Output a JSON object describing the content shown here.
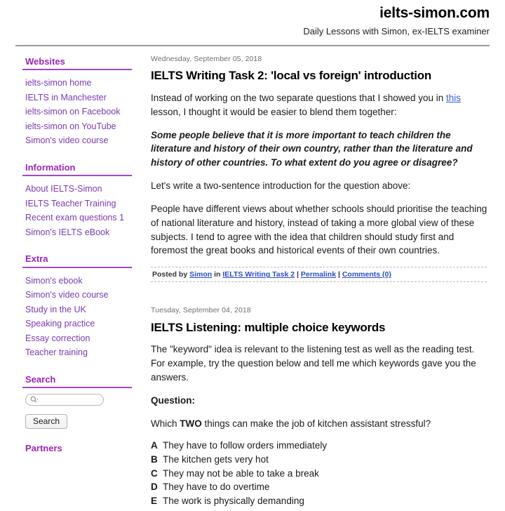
{
  "header": {
    "title": "ielts-simon.com",
    "tagline": "Daily Lessons with Simon, ex-IELTS examiner"
  },
  "sidebar": {
    "sections": [
      {
        "heading": "Websites",
        "links": [
          "ielts-simon home",
          "IELTS in Manchester",
          "ielts-simon on Facebook",
          "ielts-simon on YouTube",
          "Simon's video course"
        ]
      },
      {
        "heading": "Information",
        "links": [
          "About IELTS-Simon",
          "IELTS Teacher Training",
          "Recent exam questions 1",
          "Simon's IELTS eBook"
        ]
      },
      {
        "heading": "Extra",
        "links": [
          "Simon's ebook",
          "Simon's video course",
          "Study in the UK",
          "Speaking practice",
          "Essay correction",
          "Teacher training"
        ]
      }
    ],
    "search": {
      "heading": "Search",
      "input_value": "",
      "placeholder": "",
      "icon": "search-icon",
      "button_label": "Search"
    },
    "partners_heading": "Partners"
  },
  "posts": [
    {
      "date": "Wednesday, September 05, 2018",
      "title": "IELTS Writing Task 2: 'local vs foreign' introduction",
      "intro_before_link": "Instead of working on the two separate questions that I showed you in ",
      "intro_link": "this",
      "intro_after_link": " lesson, I thought it would be easier to blend them together:",
      "question_quote": "Some people believe that it is more important to teach children the literature and history of their own country, rather than the literature and history of other countries. To what extent do you agree or disagree?",
      "instruction": "Let's write a two-sentence introduction for the question above:",
      "answer": "People have different views about whether schools should prioritise the teaching of national literature and history, instead of taking a more global view of these subjects. I tend to agree with the idea that children should study first and foremost the great books and historical events of their own countries.",
      "footer": {
        "posted_by_label": "Posted by",
        "author": "Simon",
        "in_label": "in",
        "category": "IELTS Writing Task 2",
        "permalink_label": "Permalink",
        "comments_label": "Comments (0)"
      }
    },
    {
      "date": "Tuesday, September 04, 2018",
      "title": "IELTS Listening: multiple choice keywords",
      "intro": "The \"keyword\" idea is relevant to the listening test as well as the reading test. For example, try the question below and tell me which keywords gave you the answers.",
      "question_label": "Question:",
      "question_before_strong": "Which ",
      "question_strong": "TWO",
      "question_after_strong": " things can make the job of kitchen assistant stressful?",
      "options": [
        {
          "letter": "A",
          "text": "They have to follow orders immediately"
        },
        {
          "letter": "B",
          "text": "The kitchen gets very hot"
        },
        {
          "letter": "C",
          "text": "They may not be able to take a break"
        },
        {
          "letter": "D",
          "text": "They have to do overtime"
        },
        {
          "letter": "E",
          "text": "The work is physically demanding"
        }
      ]
    }
  ],
  "colors": {
    "heading_purple": "#9b26b6",
    "link_purple": "#7b3ab0",
    "inline_link_blue": "#3a5fcd",
    "footer_link_blue": "#2b4fc4",
    "rule_gray": "#9a9a9a"
  }
}
